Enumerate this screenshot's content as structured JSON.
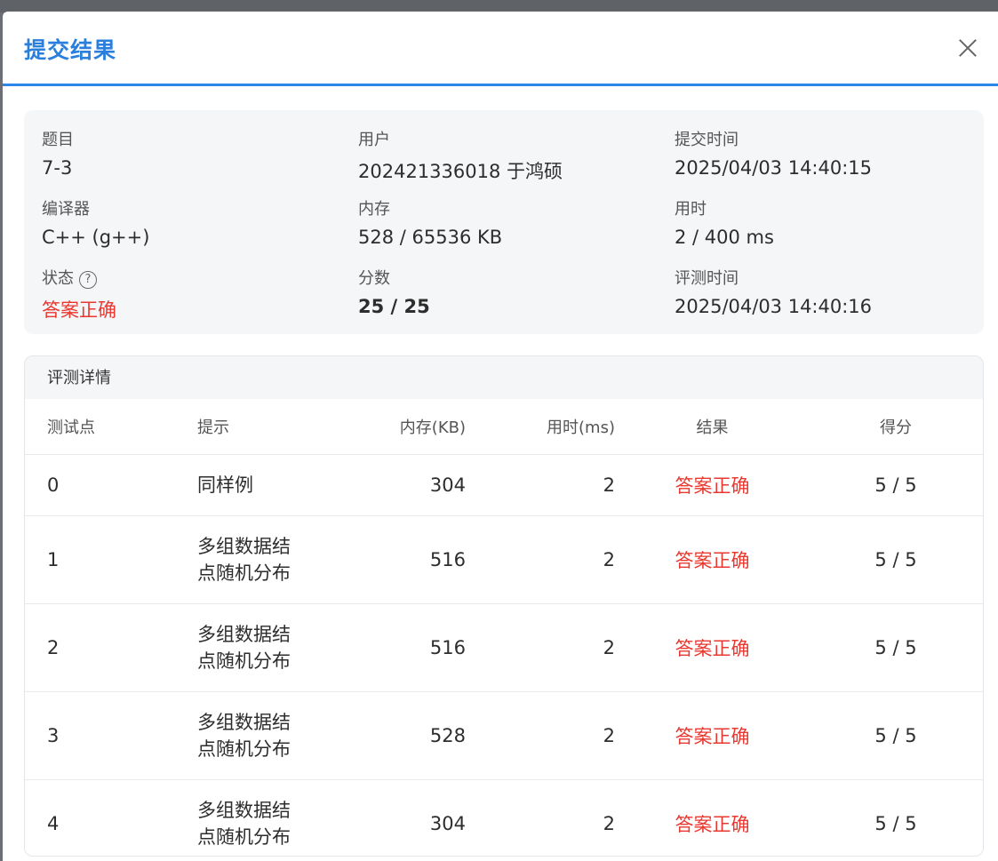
{
  "modal": {
    "title": "提交结果",
    "close_icon": "close-icon"
  },
  "info": {
    "problem": {
      "label": "题目",
      "value": "7-3"
    },
    "user": {
      "label": "用户",
      "value": "202421336018 于鸿硕"
    },
    "submit_time": {
      "label": "提交时间",
      "value": "2025/04/03 14:40:15"
    },
    "compiler": {
      "label": "编译器",
      "value": "C++ (g++)"
    },
    "memory": {
      "label": "内存",
      "value": "528 / 65536 KB"
    },
    "time_used": {
      "label": "用时",
      "value": "2 / 400 ms"
    },
    "status": {
      "label": "状态",
      "help": "?",
      "value": "答案正确"
    },
    "score": {
      "label": "分数",
      "value": "25 / 25"
    },
    "judge_time": {
      "label": "评测时间",
      "value": "2025/04/03 14:40:16"
    }
  },
  "details": {
    "title": "评测详情",
    "columns": {
      "id": "测试点",
      "hint": "提示",
      "memory": "内存(KB)",
      "time": "用时(ms)",
      "result": "结果",
      "score": "得分"
    },
    "rows": [
      {
        "id": "0",
        "hint": "同样例",
        "memory": "304",
        "time": "2",
        "result": "答案正确",
        "score": "5 / 5"
      },
      {
        "id": "1",
        "hint": "多组数据结\n点随机分布",
        "memory": "516",
        "time": "2",
        "result": "答案正确",
        "score": "5 / 5"
      },
      {
        "id": "2",
        "hint": "多组数据结\n点随机分布",
        "memory": "516",
        "time": "2",
        "result": "答案正确",
        "score": "5 / 5"
      },
      {
        "id": "3",
        "hint": "多组数据结\n点随机分布",
        "memory": "528",
        "time": "2",
        "result": "答案正确",
        "score": "5 / 5"
      },
      {
        "id": "4",
        "hint": "多组数据结\n点随机分布",
        "memory": "304",
        "time": "2",
        "result": "答案正确",
        "score": "5 / 5"
      }
    ]
  },
  "colors": {
    "accent": "#2b7fdc",
    "success_text": "#e8382f"
  }
}
